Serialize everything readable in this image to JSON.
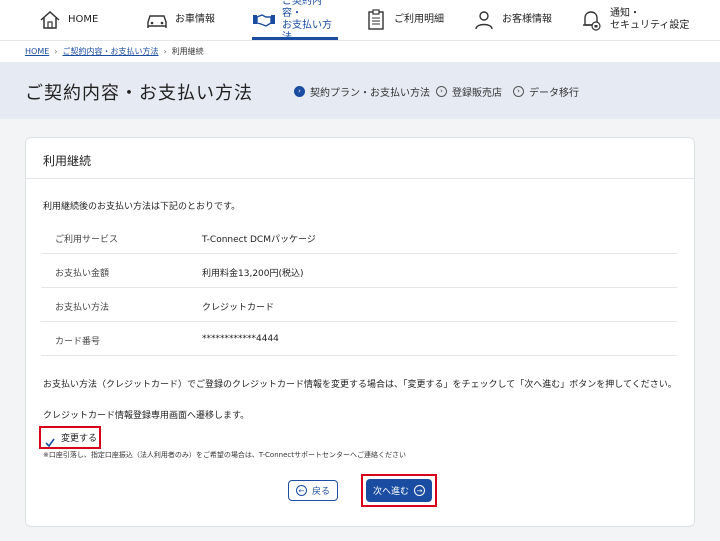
{
  "nav": {
    "items": [
      {
        "label": "HOME",
        "icon": "home-icon"
      },
      {
        "label": "お車情報",
        "icon": "car-icon"
      },
      {
        "label": "ご契約内容・\nお支払い方法",
        "icon": "handshake-icon"
      },
      {
        "label": "ご利用明細",
        "icon": "clipboard-icon"
      },
      {
        "label": "お客様情報",
        "icon": "user-icon"
      },
      {
        "label": "通知・\nセキュリティ設定",
        "icon": "bell-lock-icon"
      }
    ]
  },
  "breadcrumb": {
    "home": "HOME",
    "contract": "ご契約内容・お支払い方法",
    "current": "利用継続"
  },
  "page": {
    "title": "ご契約内容・お支払い方法",
    "subnav": [
      {
        "label": "契約プラン・お支払い方法"
      },
      {
        "label": "登録販売店"
      },
      {
        "label": "データ移行"
      }
    ]
  },
  "card": {
    "title": "利用継続",
    "intro": "利用継続後のお支払い方法は下記のとおりです。",
    "rows": [
      {
        "key": "ご利用サービス",
        "value": "T-Connect DCMパッケージ"
      },
      {
        "key": "お支払い金額",
        "value": "利用料金13,200円(税込)"
      },
      {
        "key": "お支払い方法",
        "value": "クレジットカード"
      },
      {
        "key": "カード番号",
        "value": "************4444"
      }
    ],
    "note": "お支払い方法（クレジットカード）でご登録のクレジットカード情報を変更する場合は、「変更する」をチェックして「次へ進む」ボタンを押してください。",
    "note2": "クレジットカード情報登録専用画面へ遷移します。",
    "checkbox_label": "変更する",
    "small_note": "※口座引落し、指定口座振込（法人利用者のみ）をご希望の場合は、T-Connectサポートセンターへご連絡ください",
    "back_label": "戻る",
    "next_label": "次へ進む"
  },
  "colors": {
    "accent": "#1a4da1",
    "highlight": "#d9001b",
    "title_band": "#e6ebf3"
  }
}
